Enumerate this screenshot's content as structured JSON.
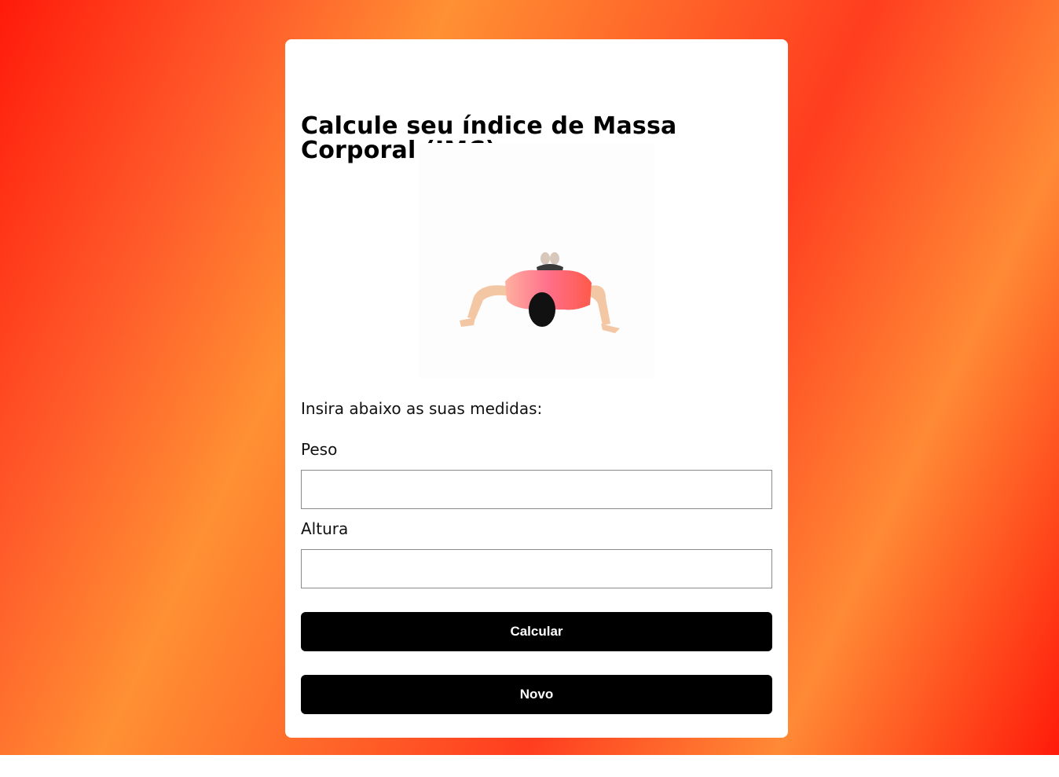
{
  "form": {
    "title": "Calcule seu índice de Massa Corporal (IMC)",
    "subtitle": "Insira abaixo as suas medidas:",
    "peso_label": "Peso",
    "peso_value": "",
    "altura_label": "Altura",
    "altura_value": "",
    "calcular_label": "Calcular",
    "novo_label": "Novo"
  },
  "illustration": {
    "icon": "person-pushup-icon"
  },
  "colors": {
    "gradient_red": "#ff1a0a",
    "gradient_orange": "#ff9033",
    "button_bg": "#000000",
    "button_text": "#ffffff",
    "shirt": "#ff6a6a",
    "skin": "#f3c7a4",
    "hair": "#111111"
  }
}
